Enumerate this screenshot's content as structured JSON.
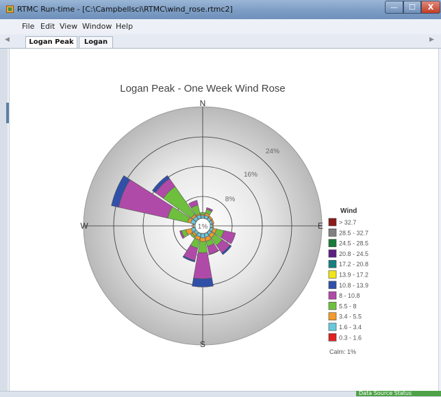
{
  "window": {
    "title": "RTMC Run-time - [C:\\Campbellsci\\RTMC\\wind_rose.rtmc2]",
    "buttons": {
      "minimize": "—",
      "maximize": "☐",
      "close": "X"
    }
  },
  "menu": [
    "File",
    "Edit",
    "View",
    "Window",
    "Help"
  ],
  "tabs": [
    {
      "label": "Logan Peak",
      "active": true
    },
    {
      "label": "Logan",
      "active": false
    }
  ],
  "status": {
    "data_source": "Data Source Status"
  },
  "colors": {
    "bin_gt_32_7": "#8b1a1a",
    "bin_28_5_32_7": "#808080",
    "bin_24_5_28_5": "#1a7a3a",
    "bin_20_8_24_5": "#5c2080",
    "bin_17_2_20_8": "#17807f",
    "bin_13_9_17_2": "#f2e51a",
    "bin_10_8_13_9": "#3050a8",
    "bin_8_10_8": "#b04aa8",
    "bin_5_5_8": "#6fbf3e",
    "bin_3_4_5_5": "#f29a2e",
    "bin_1_6_3_4": "#6ac8dc",
    "bin_0_3_1_6": "#e02020"
  },
  "chart_data": {
    "type": "wind_rose",
    "title": "Logan Peak  - One Week Wind Rose",
    "directions": [
      "N",
      "E",
      "S",
      "W"
    ],
    "rings": [
      {
        "value": 8,
        "label": "8%"
      },
      {
        "value": 16,
        "label": "16%"
      },
      {
        "value": 24,
        "label": "24%"
      }
    ],
    "rmax": 32,
    "center_label": "1%",
    "legend_title": "Wind",
    "calm_label": "Calm: 1%",
    "bins": [
      {
        "label": "> 32.7",
        "color": "#8b1a1a"
      },
      {
        "label": "28.5 - 32.7",
        "color": "#808080"
      },
      {
        "label": "24.5 - 28.5",
        "color": "#1a7a3a"
      },
      {
        "label": "20.8 - 24.5",
        "color": "#5c2080"
      },
      {
        "label": "17.2 - 20.8",
        "color": "#17807f"
      },
      {
        "label": "13.9 - 17.2",
        "color": "#f2e51a"
      },
      {
        "label": "10.8 - 13.9",
        "color": "#3050a8"
      },
      {
        "label": "8 - 10.8",
        "color": "#b04aa8"
      },
      {
        "label": "5.5 - 8",
        "color": "#6fbf3e"
      },
      {
        "label": "3.4 - 5.5",
        "color": "#f29a2e"
      },
      {
        "label": "1.6 - 3.4",
        "color": "#6ac8dc"
      },
      {
        "label": "0.3 - 1.6",
        "color": "#e02020"
      }
    ],
    "sectors": [
      {
        "dir": 0,
        "bins": {
          "0.3 - 1.6": 0.1,
          "1.6 - 3.4": 0.6,
          "3.4 - 5.5": 0.3,
          "5.5 - 8": 0.6
        }
      },
      {
        "dir": 22.5,
        "bins": {
          "0.3 - 1.6": 0.1,
          "1.6 - 3.4": 0.8,
          "3.4 - 5.5": 0.6,
          "5.5 - 8": 1.0,
          "8 - 10.8": 0.5
        }
      },
      {
        "dir": 45,
        "bins": {
          "1.6 - 3.4": 0.7,
          "3.4 - 5.5": 0.5
        }
      },
      {
        "dir": 67.5,
        "bins": {
          "1.6 - 3.4": 0.7,
          "3.4 - 5.5": 0.4
        }
      },
      {
        "dir": 90,
        "bins": {
          "1.6 - 3.4": 0.6,
          "3.4 - 5.5": 0.3
        }
      },
      {
        "dir": 112.5,
        "bins": {
          "0.3 - 1.6": 0.1,
          "1.6 - 3.4": 0.8,
          "3.4 - 5.5": 0.9,
          "5.5 - 8": 2.0,
          "8 - 10.8": 3.2
        }
      },
      {
        "dir": 135,
        "bins": {
          "0.3 - 1.6": 0.1,
          "1.6 - 3.4": 0.8,
          "3.4 - 5.5": 1.0,
          "5.5 - 8": 2.5,
          "8 - 10.8": 2.5,
          "10.8 - 13.9": 0.5
        }
      },
      {
        "dir": 157.5,
        "bins": {
          "0.3 - 1.6": 0.1,
          "1.6 - 3.4": 1.0,
          "3.4 - 5.5": 1.1,
          "5.5 - 8": 1.4,
          "8 - 10.8": 2.2
        }
      },
      {
        "dir": 180,
        "bins": {
          "0.3 - 1.6": 0.1,
          "1.6 - 3.4": 1.1,
          "3.4 - 5.5": 1.0,
          "5.5 - 8": 3.0,
          "8 - 10.8": 7.0,
          "10.8 - 13.9": 2.2
        }
      },
      {
        "dir": 202.5,
        "bins": {
          "0.3 - 1.6": 0.1,
          "1.6 - 3.4": 0.9,
          "3.4 - 5.5": 0.9,
          "5.5 - 8": 2.2,
          "8 - 10.8": 3.4,
          "10.8 - 13.9": 0.4
        }
      },
      {
        "dir": 225,
        "bins": {
          "1.6 - 3.4": 0.8,
          "3.4 - 5.5": 0.6,
          "5.5 - 8": 0.6
        }
      },
      {
        "dir": 247.5,
        "bins": {
          "0.3 - 1.6": 0.1,
          "1.6 - 3.4": 1.0,
          "3.4 - 5.5": 1.5,
          "5.5 - 8": 1.2,
          "8 - 10.8": 0.5
        }
      },
      {
        "dir": 270,
        "bins": {
          "1.6 - 3.4": 0.5,
          "3.4 - 5.5": 0.3
        }
      },
      {
        "dir": 292.5,
        "bins": {
          "0.3 - 1.6": 0.1,
          "1.6 - 3.4": 1.2,
          "3.4 - 5.5": 0.8,
          "5.5 - 8": 5.5,
          "8 - 10.8": 13.5,
          "10.8 - 13.9": 2.0
        }
      },
      {
        "dir": 315,
        "bins": {
          "0.3 - 1.6": 0.1,
          "1.6 - 3.4": 1.0,
          "3.4 - 5.5": 0.6,
          "5.5 - 8": 9.2,
          "8 - 10.8": 2.6,
          "10.8 - 13.9": 1.0
        }
      },
      {
        "dir": 337.5,
        "bins": {
          "0.3 - 1.6": 0.1,
          "1.6 - 3.4": 0.9,
          "3.4 - 5.5": 0.3,
          "5.5 - 8": 2.4,
          "8 - 10.8": 1.3
        }
      }
    ]
  }
}
